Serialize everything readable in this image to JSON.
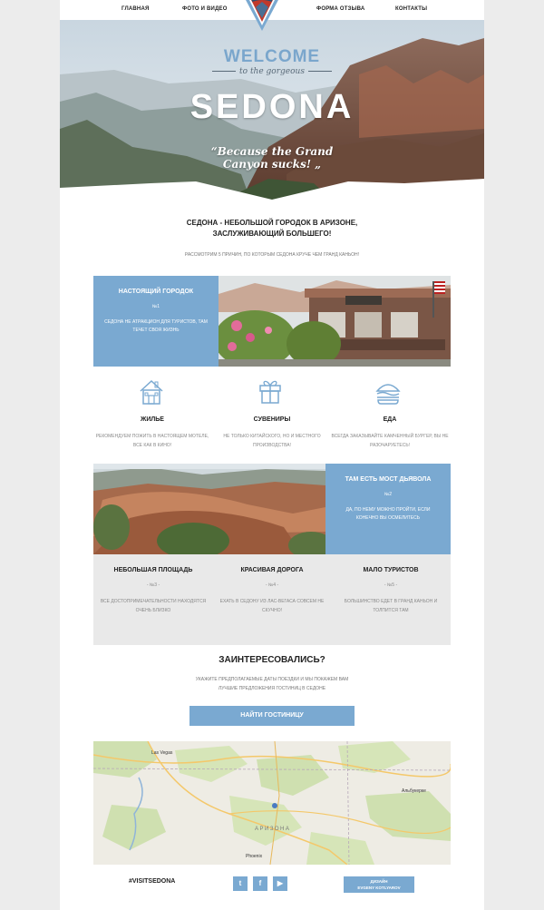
{
  "nav": {
    "home": "ГЛАВНАЯ",
    "photo": "ФОТО И ВИДЕО",
    "logo_text": "CITY OF SEDONA",
    "feedback": "ФОРМА ОТЗЫВА",
    "contacts": "КОНТАКТЫ"
  },
  "hero": {
    "welcome": "WELCOME",
    "subtitle": "to the gorgeous",
    "title": "SEDONA",
    "quote_line1": "“Because the Grand",
    "quote_line2": "Canyon sucks! „"
  },
  "intro": {
    "title": "СЕДОНА - НЕБОЛЬШОЙ ГОРОДОК В АРИЗОНЕ, ЗАСЛУЖИВАЮЩИЙ БОЛЬШЕГО!",
    "subtitle": "РАССМОТРИМ 5 ПРИЧИН, ПО КОТОРЫМ СЕДОНА КРУЧЕ ЧЕМ ГРАНД КАНЬОН!"
  },
  "reason1": {
    "title": "НАСТОЯЩИЙ ГОРОДОК",
    "number": "№1",
    "text": "СЕДОНА НЕ АТРАКЦИОН ДЛЯ ТУРИСТОВ, ТАМ ТЕЧЕТ СВОЯ ЖИЗНЬ"
  },
  "features": [
    {
      "icon": "house-icon",
      "title": "ЖИЛЬЕ",
      "text": "РЕКОМЕНДУЕМ ПОЖИТЬ В НАСТОЯЩЕМ МОТЕЛЕ, ВСЕ КАК В КИНО!"
    },
    {
      "icon": "gift-icon",
      "title": "СУВЕНИРЫ",
      "text": "НЕ ТОЛЬКО КИТАЙСКОГО, НО И МЕСТНОГО ПРОИЗВОДСТВА!"
    },
    {
      "icon": "burger-icon",
      "title": "ЕДА",
      "text": "ВСЕГДА ЗАКАЗЫВАЙТЕ КАМЧЕННЫЙ БУРГЕР, ВЫ НЕ РАЗОЧАРУЕТЕСЬ!"
    }
  ],
  "reason2": {
    "title": "ТАМ ЕСТЬ МОСТ ДЬЯВОЛА",
    "number": "№2",
    "text": "ДА, ПО НЕМУ МОЖНО ПРОЙТИ, ЕСЛИ КОНЕЧНО ВЫ ОСМЕЛИТЕСЬ"
  },
  "reasons_more": [
    {
      "title": "НЕБОЛЬШАЯ ПЛОЩАДЬ",
      "number": "- №3 -",
      "text": "ВСЕ ДОСТОПРИМЕЧАТЕЛЬНОСТИ НАХОДЯТСЯ ОЧЕНЬ БЛИЗКО"
    },
    {
      "title": "КРАСИВАЯ ДОРОГА",
      "number": "- №4 -",
      "text": "ЕХАТЬ В СЕДОНУ ИЗ ЛАС-ВЕГАСА СОВСЕМ НЕ СКУЧНО!"
    },
    {
      "title": "МАЛО ТУРИСТОВ",
      "number": "- №5 -",
      "text": "БОЛЬШИНСТВО ЕДЕТ В ГРАНД КАНЬОН И ТОЛПИТСЯ ТАМ"
    }
  ],
  "cta": {
    "title": "ЗАИНТЕРЕСОВАЛИСЬ?",
    "text": "УКАЖИТЕ ПРЕДПОЛАГАЕМЫЕ ДАТЫ ПОЕЗДКИ И МЫ ПОКАЖЕМ ВАМ ЛУЧШИЕ ПРЕДЛОЖЕНИЯ ГОСТИНИЦ В СЕДОНЕ",
    "button": "НАЙТИ ГОСТИНИЦУ"
  },
  "map": {
    "las_vegas": "Las Vegas",
    "arizona": "АРИЗОНА",
    "albuquerque": "Альбукерке",
    "phoenix": "Phoenix"
  },
  "footer": {
    "hashtag": "#VISITSEDONA",
    "twitter": "t",
    "facebook": "f",
    "youtube": "▶",
    "credit_line1": "ДИЗАЙН",
    "credit_line2": "EVGENY KOTLYAROV"
  },
  "colors": {
    "accent": "#7aa9d1",
    "gray_panel": "#e9e9e9"
  }
}
